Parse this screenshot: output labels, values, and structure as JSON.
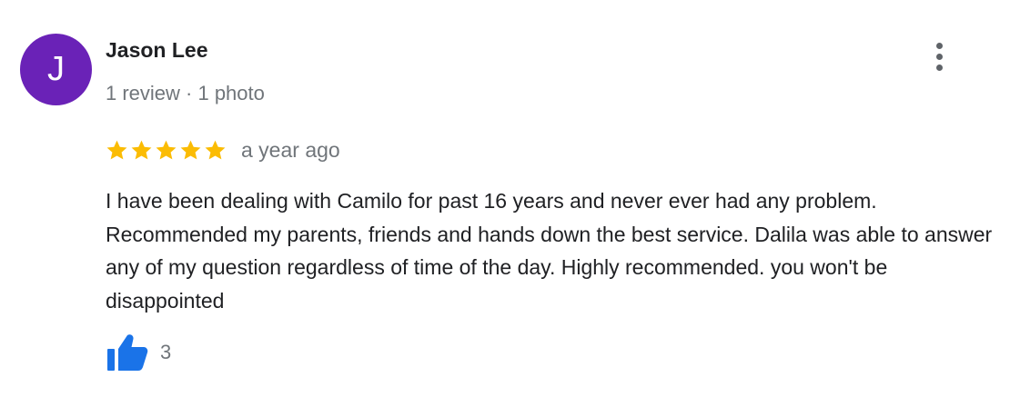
{
  "reviewer": {
    "initial": "J",
    "avatar_color": "#6a22b7",
    "name": "Jason Lee",
    "meta": "1 review · 1 photo"
  },
  "rating": {
    "stars": 5,
    "max_stars": 5,
    "star_color": "#fbbc04",
    "time": "a year ago"
  },
  "review": {
    "text": "I have been dealing with Camilo for past 16 years and never ever had any problem. Recommended my parents, friends and hands down the best service. Dalila was able to answer any of my question regardless of time of the day. Highly recommended. you won't be disappointed"
  },
  "actions": {
    "more_icon": "more-vertical-icon",
    "like_icon": "thumbs-up-icon",
    "like_color": "#1a73e8",
    "like_count": "3"
  }
}
